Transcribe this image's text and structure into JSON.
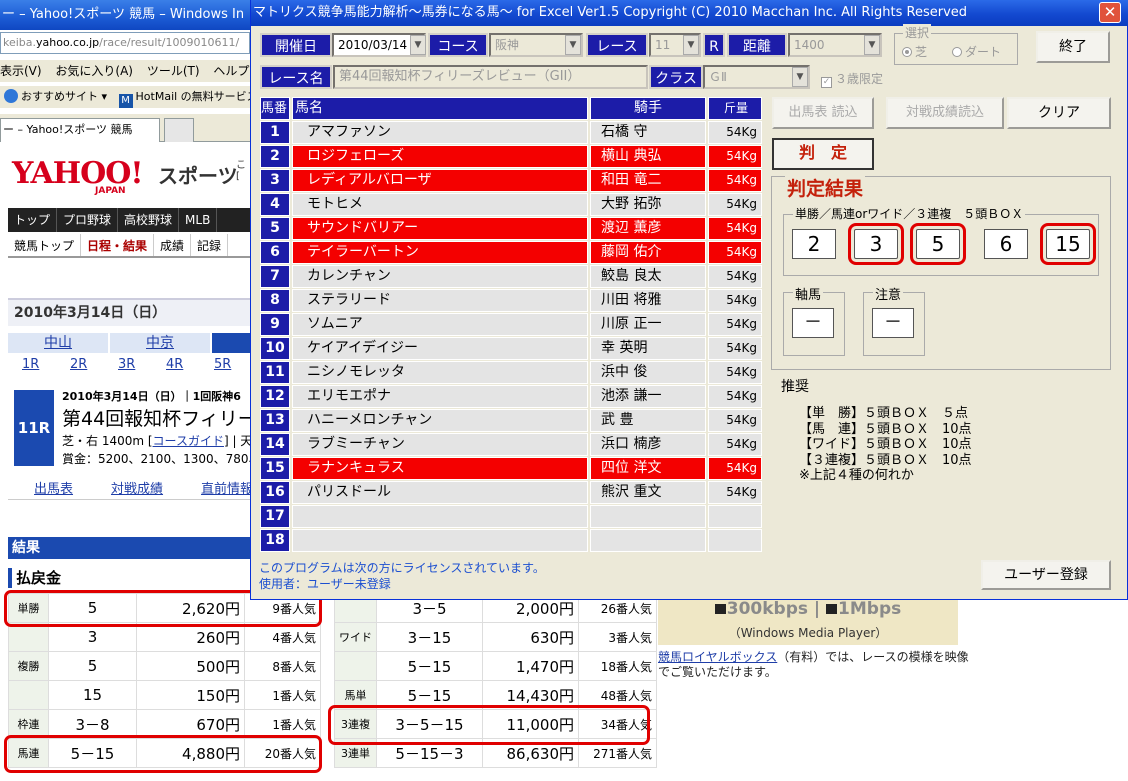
{
  "browser": {
    "title": "ー – Yahoo!スポーツ 競馬 – Windows In",
    "address_prefix": "keiba.",
    "address_domain": "yahoo.co.jp",
    "address_suffix": "/race/result/1009010611/",
    "menu": [
      "表示(V)",
      "お気に入り(A)",
      "ツール(T)",
      "ヘルプ(H)"
    ],
    "favorites": [
      "おすすめサイト ▾",
      "HotMail の無料サービス"
    ],
    "tab_label": "ー – Yahoo!スポーツ 競馬"
  },
  "yahoo": {
    "logo": "YAHOO!",
    "logo_japan": "JAPAN",
    "sports": "スポーツ",
    "sports_side": "こ\n[",
    "nav": [
      "トップ",
      "プロ野球",
      "高校野球",
      "MLB"
    ],
    "subnav": [
      "競馬トップ",
      "日程・結果",
      "成績",
      "記録"
    ],
    "date_header": "2010年3月14日（日）",
    "venues": [
      "中山",
      "中京",
      ""
    ],
    "races": [
      "1R",
      "2R",
      "3R",
      "4R",
      "5R"
    ],
    "race_no": "11R",
    "race_date": "2010年3月14日（日）｜1回阪神6",
    "race_name": "第44回報知杯フィリー",
    "race_cond_pre": "芝・右 1400m [",
    "race_cond_link": "コースガイド",
    "race_cond_post": "] | 天気",
    "race_prize": "賞金：5200、2100、1300、780、52",
    "links": [
      "出馬表",
      "対戦成績",
      "直前情報"
    ],
    "result_bar": "結果",
    "payout_title": "払戻金",
    "payout_left": [
      {
        "kind": "単勝",
        "num": "5",
        "yen": "2,620円",
        "pop": "9番人気"
      },
      {
        "kind": "",
        "num": "3",
        "yen": "260円",
        "pop": "4番人気"
      },
      {
        "kind": "複勝",
        "num": "5",
        "yen": "500円",
        "pop": "8番人気"
      },
      {
        "kind": "",
        "num": "15",
        "yen": "150円",
        "pop": "1番人気"
      },
      {
        "kind": "枠連",
        "num": "3－8",
        "yen": "670円",
        "pop": "1番人気"
      },
      {
        "kind": "馬連",
        "num": "5－15",
        "yen": "4,880円",
        "pop": "20番人気"
      }
    ],
    "payout_right": [
      {
        "kind": "",
        "num": "3－5",
        "yen": "2,000円",
        "pop": "26番人気"
      },
      {
        "kind": "ワイド",
        "num": "3－15",
        "yen": "630円",
        "pop": "3番人気"
      },
      {
        "kind": "",
        "num": "5－15",
        "yen": "1,470円",
        "pop": "18番人気"
      },
      {
        "kind": "馬単",
        "num": "5－15",
        "yen": "14,430円",
        "pop": "48番人気"
      },
      {
        "kind": "3連複",
        "num": "3－5－15",
        "yen": "11,000円",
        "pop": "34番人気"
      },
      {
        "kind": "3連単",
        "num": "5－15－3",
        "yen": "86,630円",
        "pop": "271番人気"
      }
    ],
    "media_speed_a": "300kbps",
    "media_sep": " | ",
    "media_speed_b": "1Mbps",
    "media_player": "（Windows Media Player）",
    "media_link": "競馬ロイヤルボックス",
    "media_desc1": "（有料）では、レースの模様を映像",
    "media_desc2": "でご覧いただけます。"
  },
  "app": {
    "title": "マトリクス競争馬能力解析～馬券になる馬～ for Excel Ver1.5 Copyright (C) 2010 Macchan Inc. All Rights Reserved",
    "close": "✕",
    "labels": {
      "date": "開催日",
      "course": "コース",
      "race": "レース",
      "r": "R",
      "distance": "距離",
      "race_name": "レース名",
      "class": "クラス"
    },
    "values": {
      "date": "2010/03/14",
      "course": "阪神",
      "race": "11",
      "distance": "1400",
      "race_name": "第44回報知杯フィリーズレビュー（GII）",
      "class": "ＧⅡ"
    },
    "select_title": "選択",
    "radio_turf": "芝",
    "radio_dirt": "ダート",
    "check_3yo": "３歳限定",
    "btn_exit": "終了",
    "btn_load_entries": "出馬表 読込",
    "btn_load_records": "対戦成績読込",
    "btn_clear": "クリア",
    "btn_judge": "判　定",
    "grid_headers": {
      "no": "馬番",
      "name": "馬名",
      "jockey": "騎手",
      "weight": "斤量"
    },
    "horses": [
      {
        "no": "1",
        "name": "アマファソン",
        "jockey": "石橋 守",
        "weight": "54Kg",
        "red": false
      },
      {
        "no": "2",
        "name": "ロジフェローズ",
        "jockey": "横山 典弘",
        "weight": "54Kg",
        "red": true
      },
      {
        "no": "3",
        "name": "レディアルバローザ",
        "jockey": "和田 竜二",
        "weight": "54Kg",
        "red": true
      },
      {
        "no": "4",
        "name": "モトヒメ",
        "jockey": "大野 拓弥",
        "weight": "54Kg",
        "red": false
      },
      {
        "no": "5",
        "name": "サウンドバリアー",
        "jockey": "渡辺 薫彦",
        "weight": "54Kg",
        "red": true
      },
      {
        "no": "6",
        "name": "テイラーバートン",
        "jockey": "藤岡 佑介",
        "weight": "54Kg",
        "red": true
      },
      {
        "no": "7",
        "name": "カレンチャン",
        "jockey": "鮫島 良太",
        "weight": "54Kg",
        "red": false
      },
      {
        "no": "8",
        "name": "ステラリード",
        "jockey": "川田 将雅",
        "weight": "54Kg",
        "red": false
      },
      {
        "no": "9",
        "name": "ソムニア",
        "jockey": "川原 正一",
        "weight": "54Kg",
        "red": false
      },
      {
        "no": "10",
        "name": "ケイアイデイジー",
        "jockey": "幸 英明",
        "weight": "54Kg",
        "red": false
      },
      {
        "no": "11",
        "name": "ニシノモレッタ",
        "jockey": "浜中 俊",
        "weight": "54Kg",
        "red": false
      },
      {
        "no": "12",
        "name": "エリモエポナ",
        "jockey": "池添 謙一",
        "weight": "54Kg",
        "red": false
      },
      {
        "no": "13",
        "name": "ハニーメロンチャン",
        "jockey": "武 豊",
        "weight": "54Kg",
        "red": false
      },
      {
        "no": "14",
        "name": "ラブミーチャン",
        "jockey": "浜口 楠彦",
        "weight": "54Kg",
        "red": false
      },
      {
        "no": "15",
        "name": "ラナンキュラス",
        "jockey": "四位 洋文",
        "weight": "54Kg",
        "red": true
      },
      {
        "no": "16",
        "name": "パリスドール",
        "jockey": "熊沢 重文",
        "weight": "54Kg",
        "red": false
      },
      {
        "no": "17",
        "name": "",
        "jockey": "",
        "weight": "",
        "red": false
      },
      {
        "no": "18",
        "name": "",
        "jockey": "",
        "weight": "",
        "red": false
      }
    ],
    "verdict_title": "判定結果",
    "box_title": "単勝／馬連orワイド／３連複　５頭ＢＯＸ",
    "box_numbers": [
      {
        "value": "2",
        "hl": false
      },
      {
        "value": "3",
        "hl": true
      },
      {
        "value": "5",
        "hl": true
      },
      {
        "value": "6",
        "hl": false
      },
      {
        "value": "15",
        "hl": true
      }
    ],
    "axis_title": "軸馬",
    "axis_value": "－",
    "caution_title": "注意",
    "caution_value": "－",
    "recommend_title": "推奨",
    "recommend_lines": "【単　勝】５頭ＢＯＸ　５点\n【馬　連】５頭ＢＯＸ　10点\n【ワイド】５頭ＢＯＸ　10点\n【３連複】５頭ＢＯＸ　10点\n※上記４種の何れか",
    "license1": "このプログラムは次の方にライセンスされています。",
    "license2": "使用者：ユーザー未登録",
    "btn_register": "ユーザー登録"
  }
}
